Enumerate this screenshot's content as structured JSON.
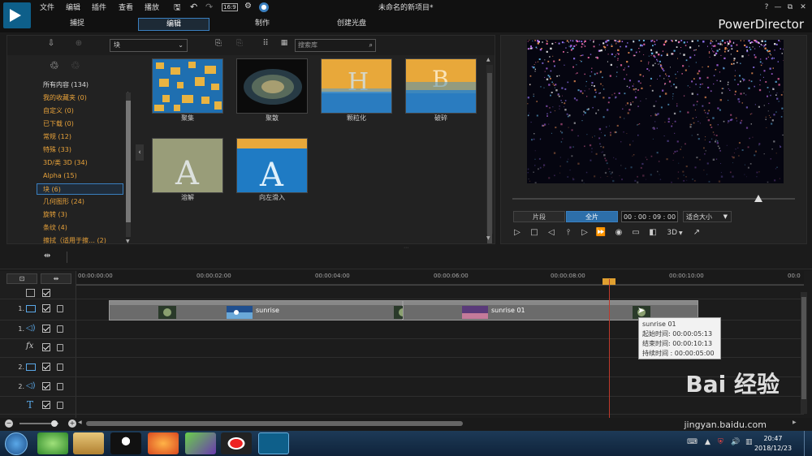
{
  "window": {
    "title": "未命名的新项目*",
    "brand": "PowerDirector",
    "menu": [
      "文件",
      "编辑",
      "插件",
      "查看",
      "播放"
    ],
    "zoom_box": "16:9",
    "tabs": [
      "捕捉",
      "编辑",
      "制作",
      "创建光盘"
    ],
    "active_tab": "编辑",
    "controls": [
      "?",
      "—",
      "⧉",
      "✕"
    ]
  },
  "library": {
    "category_select": "块",
    "search_placeholder": "搜索库",
    "categories": [
      "所有内容 (134)",
      "我的收藏夹  (0)",
      "自定义  (0)",
      "已下载  (0)",
      "常规  (12)",
      "特殊  (33)",
      "3D/类 3D  (34)",
      "Alpha  (15)",
      "块  (6)",
      "几何图形  (24)",
      "旋转  (3)",
      "条纹  (4)",
      "擦拭（适用于擦…  (2)"
    ],
    "selected_category": "块  (6)",
    "transitions": [
      {
        "label": "聚集",
        "style": "gather"
      },
      {
        "label": "聚散",
        "style": "scatter"
      },
      {
        "label": "颗粒化",
        "style": "grain"
      },
      {
        "label": "破碎",
        "style": "shatter"
      },
      {
        "label": "溶解",
        "style": "dissolve"
      },
      {
        "label": "向左滑入",
        "style": "slide"
      }
    ]
  },
  "preview": {
    "mode_clip": "片段",
    "mode_movie": "全片",
    "timecode": "00 : 00 : 09 : 00",
    "fit": "适合大小",
    "three_d": "3D",
    "progress_fraction": 0.87
  },
  "timeline": {
    "ruler_labels": [
      "00:00:00:00",
      "00:00:02:00",
      "00:00:04:00",
      "00:00:06:00",
      "00:00:08:00",
      "00:00:10:00",
      "00:0"
    ],
    "tracks": [
      {
        "num": "1.",
        "type": "video"
      },
      {
        "num": "1.",
        "type": "audio"
      },
      {
        "num": "",
        "type": "fx"
      },
      {
        "num": "2.",
        "type": "video"
      },
      {
        "num": "2.",
        "type": "audio"
      },
      {
        "num": "",
        "type": "text"
      }
    ],
    "clips": [
      {
        "name": "sunrise"
      },
      {
        "name": "sunrise 01"
      }
    ],
    "tooltip": {
      "title": "sunrise 01",
      "start": "起始时间: 00:00:05:13",
      "end": "结束时间: 00:00:10:13",
      "duration": "持续时间 :  00:00:05:00"
    }
  },
  "taskbar": {
    "time": "20:47",
    "date": "2018/12/23"
  },
  "watermark": {
    "logo": "Bai 经验",
    "url": "jingyan.baidu.com"
  }
}
